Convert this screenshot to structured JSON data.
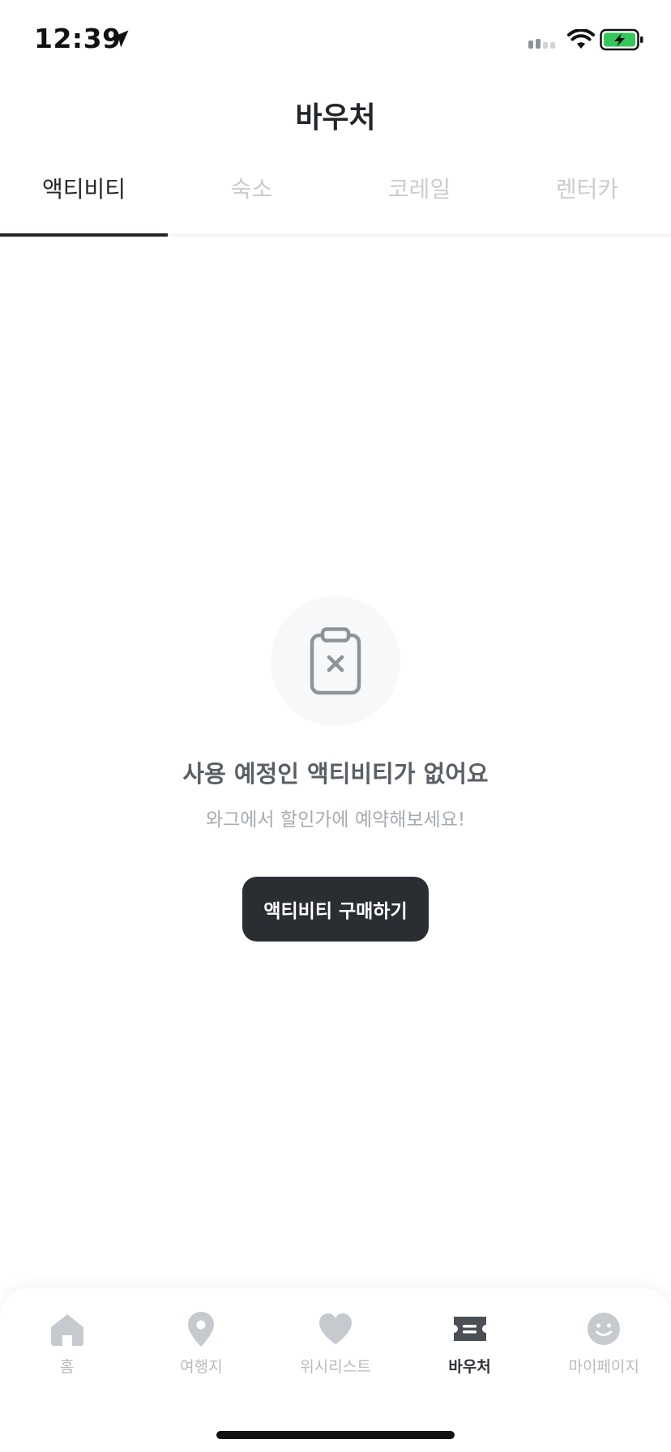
{
  "status_bar": {
    "time": "12:39"
  },
  "header": {
    "title": "바우처"
  },
  "tabs": [
    {
      "label": "액티비티",
      "active": true
    },
    {
      "label": "숙소",
      "active": false
    },
    {
      "label": "코레일",
      "active": false
    },
    {
      "label": "렌터카",
      "active": false
    }
  ],
  "empty_state": {
    "icon": "clipboard-x-icon",
    "title": "사용 예정인 액티비티가 없어요",
    "subtitle": "와그에서 할인가에 예약해보세요!",
    "button_label": "액티비티 구매하기"
  },
  "bottom_nav": [
    {
      "label": "홈",
      "icon": "home-icon",
      "active": false
    },
    {
      "label": "여행지",
      "icon": "location-pin-icon",
      "active": false
    },
    {
      "label": "위시리스트",
      "icon": "heart-icon",
      "active": false
    },
    {
      "label": "바우처",
      "icon": "ticket-icon",
      "active": true
    },
    {
      "label": "마이페이지",
      "icon": "smiley-icon",
      "active": false
    }
  ],
  "colors": {
    "primary_dark": "#2a2e33",
    "inactive": "#b7bbc0",
    "battery_green": "#34c759"
  }
}
